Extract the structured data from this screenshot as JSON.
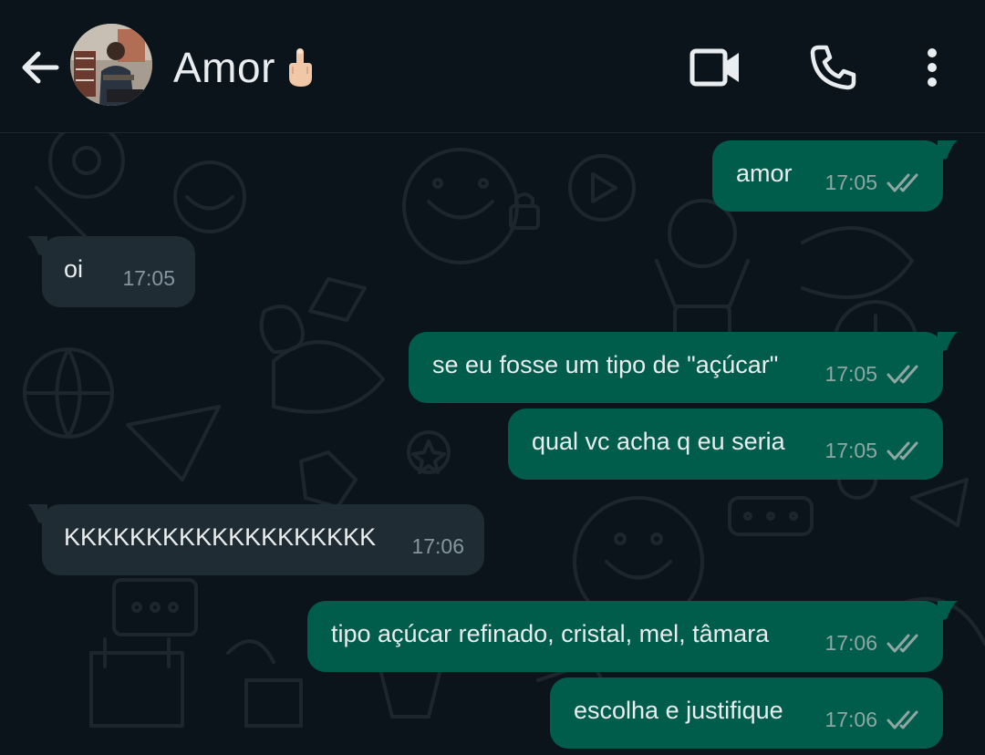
{
  "header": {
    "contact_name": "Amor",
    "contact_emoji": "🖕",
    "back_icon": "arrow-left-icon",
    "video_icon": "video-camera-icon",
    "call_icon": "phone-icon",
    "menu_icon": "more-vertical-icon"
  },
  "colors": {
    "background": "#0b141a",
    "outgoing_bubble": "#005c4b",
    "incoming_bubble": "#202c33",
    "text": "#e9edef",
    "read_ticks": "#8fa7a3"
  },
  "messages": [
    {
      "direction": "out",
      "text": "amor",
      "time": "17:05",
      "status": "read"
    },
    {
      "direction": "in",
      "text": "oi",
      "time": "17:05"
    },
    {
      "direction": "out",
      "text": "se eu fosse um tipo de \"açúcar\"",
      "time": "17:05",
      "status": "read"
    },
    {
      "direction": "out",
      "text": "qual vc acha q eu seria",
      "time": "17:05",
      "status": "read"
    },
    {
      "direction": "in",
      "text": "KKKKKKKKKKKKKKKKKKK",
      "time": "17:06"
    },
    {
      "direction": "out",
      "text": "tipo açúcar refinado, cristal, mel, tâmara",
      "time": "17:06",
      "status": "read"
    },
    {
      "direction": "out",
      "text": "escolha e justifique",
      "time": "17:06",
      "status": "read"
    }
  ]
}
